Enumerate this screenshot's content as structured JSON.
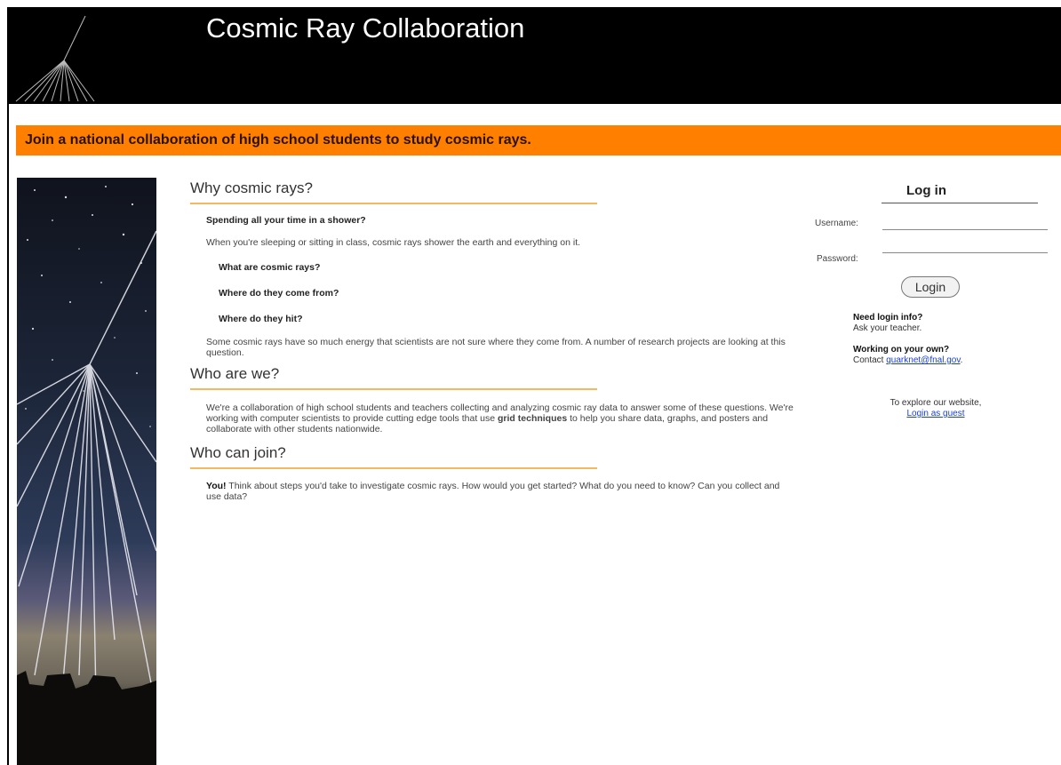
{
  "header": {
    "title": "Cosmic Ray Collaboration"
  },
  "banner": {
    "text": "Join a national collaboration of high school students to study cosmic rays."
  },
  "sections": [
    {
      "title": "Why cosmic rays?",
      "subhead": "Spending all your time in a shower?",
      "intro": "When you're sleeping or sitting in class, cosmic rays shower the earth and everything on it.",
      "questions": [
        "What are cosmic rays?",
        "Where do they come from?",
        "Where do they hit?"
      ],
      "outro": "Some cosmic rays have so much energy that scientists are not sure where they come from. A number of research projects are looking at this question."
    },
    {
      "title": "Who are we?",
      "body_before": "We're a collaboration of high school students and teachers collecting and analyzing cosmic ray data to answer some of these questions. We're working with computer scientists to provide cutting edge tools that use ",
      "body_bold": "grid techniques",
      "body_after": " to help you share data, graphs, and posters and collaborate with other students nationwide."
    },
    {
      "title": "Who can join?",
      "body_bold": "You!",
      "body_after": " Think about steps you'd take to investigate cosmic rays. How would you get started? What do you need to know? Can you collect and use data?"
    }
  ],
  "login": {
    "title": "Log in",
    "username_label": "Username:",
    "password_label": "Password:",
    "username_value": "",
    "password_value": "",
    "button_label": "Login",
    "need_info_heading": "Need login info?",
    "need_info_text": "Ask your teacher.",
    "own_heading": "Working on your own?",
    "own_text": "Contact ",
    "own_email": "quarknet@fnal.gov",
    "own_trailing": ".",
    "explore_text": "To explore our website,",
    "guest_link": "Login as guest"
  },
  "icons": {
    "header_logo": "cosmic-shower-logo-icon",
    "side_image": "cosmic-shower-photo"
  },
  "colors": {
    "banner": "#ff7f00",
    "header": "#000000",
    "underline": "#f4b860",
    "link": "#1a3fd6"
  }
}
